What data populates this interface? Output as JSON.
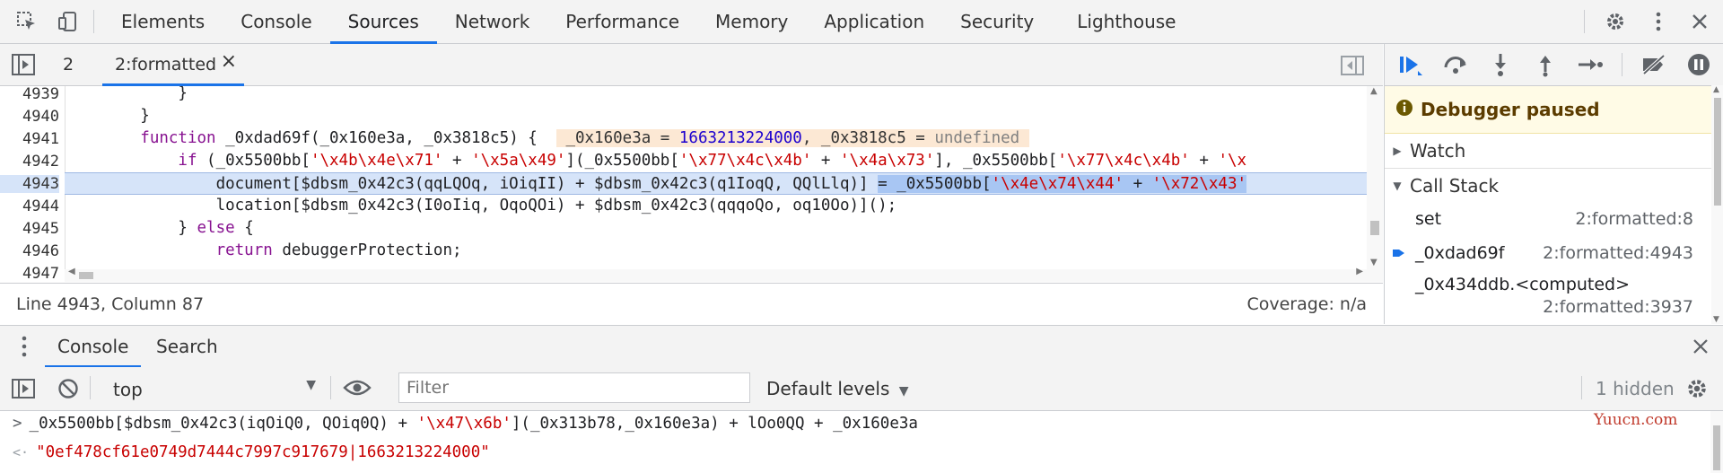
{
  "toolbar": {
    "tabs": [
      "Elements",
      "Console",
      "Sources",
      "Network",
      "Performance",
      "Memory",
      "Application",
      "Security",
      "Lighthouse"
    ],
    "active_tab": "Sources"
  },
  "file_tabs": {
    "items": [
      "2",
      "2:formatted"
    ],
    "close_glyph": "×"
  },
  "editor": {
    "line_numbers": [
      "4939",
      "4940",
      "4941",
      "4942",
      "4943",
      "4944",
      "4945",
      "4946",
      "4947"
    ],
    "inline_values": {
      "a_name": "_0x160e3a",
      "a_eq": " = ",
      "a_val": "1663213224000",
      "sep": ", ",
      "b_name": "_0x3818c5",
      "b_eq": " = ",
      "b_val": "undefined"
    },
    "highlighted_line": "4943"
  },
  "status": {
    "position": "Line 4943, Column 87",
    "coverage": "Coverage: n/a"
  },
  "debugger": {
    "paused_text": "Debugger paused",
    "watch_label": "Watch",
    "callstack_label": "Call Stack",
    "frames": [
      {
        "name": "set",
        "location": "2:formatted:8"
      },
      {
        "name": "_0xdad69f",
        "location": "2:formatted:4943"
      },
      {
        "name": "_0x434ddb.<computed>",
        "location": "2:formatted:3937"
      }
    ]
  },
  "drawer": {
    "tabs": [
      "Console",
      "Search"
    ],
    "active": "Console"
  },
  "console_toolbar": {
    "context": "top",
    "filter_placeholder": "Filter",
    "levels": "Default levels",
    "hidden": "1 hidden"
  },
  "console": {
    "input_prompt": ">",
    "output_prompt": "<·",
    "result": "\"0ef478cf61e0749d7444c7997c917679|1663213224000\""
  },
  "watermark": "Yuucn.com",
  "colors": {
    "accent": "#1a73e8",
    "string": "#c80000",
    "keyword": "#881391",
    "paused_bg": "#fffbe6"
  }
}
